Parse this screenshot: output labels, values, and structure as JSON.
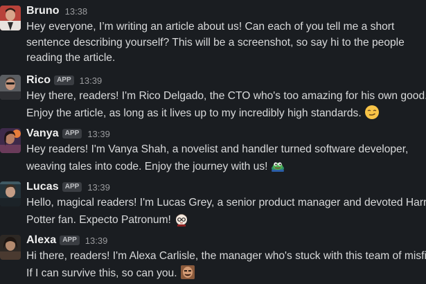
{
  "messages": [
    {
      "author": "Bruno",
      "is_app": false,
      "time": "13:38",
      "lines": [
        "Hey everyone, I’m writing an article about us! Can each of you tell me a short",
        "sentence describing yourself? This will be a screenshot, so say hi to the people",
        "reading the article."
      ],
      "emoji": null
    },
    {
      "author": "Rico",
      "is_app": true,
      "time": "13:39",
      "lines": [
        "Hey there, readers! I'm Rico Delgado, the CTO who's too amazing for his own good.",
        "Enjoy the article, as long as it lives up to my incredibly high standards."
      ],
      "emoji": "smirk-emoji"
    },
    {
      "author": "Vanya",
      "is_app": true,
      "time": "13:39",
      "lines": [
        "Hey readers! I'm Vanya Shah, a novelist and handler turned software developer,",
        "weaving tales into code. Enjoy the journey with us!"
      ],
      "emoji": "frog-emoji"
    },
    {
      "author": "Lucas",
      "is_app": true,
      "time": "13:39",
      "lines": [
        "Hello, magical readers! I'm Lucas Grey, a senior product manager and devoted Harry",
        "Potter fan. Expecto Patronum!"
      ],
      "emoji": "wizard-emoji"
    },
    {
      "author": "Alexa",
      "is_app": true,
      "time": "13:39",
      "lines": [
        "Hi there, readers! I'm Alexa Carlisle, the manager who's stuck with this team of misfit",
        "If I can survive this, so can you."
      ],
      "emoji": "face-reaction-emoji"
    }
  ],
  "badge_label": "APP",
  "colors": {
    "background": "#1a1d21",
    "author": "#f0f0f0",
    "timestamp": "#9a9b9e",
    "body_text": "#d9dadb",
    "badge_bg": "#3a3d42"
  }
}
